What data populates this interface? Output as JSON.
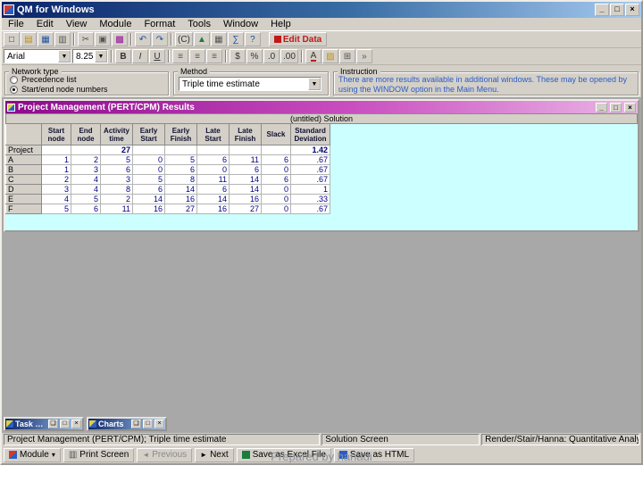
{
  "window": {
    "title": "QM for Windows",
    "menu": [
      "File",
      "Edit",
      "View",
      "Module",
      "Format",
      "Tools",
      "Window",
      "Help"
    ]
  },
  "toolbar": {
    "edit_data_label": "Edit Data",
    "copy_c_label": "(C)",
    "font_name": "Arial",
    "font_size": "8.25",
    "bold_label": "B",
    "italic_label": "I",
    "underline_label": "U",
    "currency_label": "$",
    "percent_label": "%",
    "dec0_label": ".0",
    "dec00_label": ".00",
    "font_color_label": "A"
  },
  "options": {
    "network_type_label": "Network type",
    "radio_precedence": "Precedence list",
    "radio_startend": "Start/end node numbers",
    "method_label": "Method",
    "method_value": "Triple time estimate",
    "instruction_label": "Instruction",
    "instruction_text": "There are more results available in additional windows. These may be opened by using the WINDOW option in the Main Menu."
  },
  "results": {
    "title": "Project Management (PERT/CPM) Results",
    "table_title": "(untitled) Solution",
    "columns": [
      "Start node",
      "End node",
      "Activity time",
      "Early Start",
      "Early Finish",
      "Late Start",
      "Late Finish",
      "Slack",
      "Standard Deviation"
    ],
    "rows": [
      {
        "name": "Project",
        "values": [
          "",
          "",
          "27",
          "",
          "",
          "",
          "",
          "",
          "1.42"
        ],
        "bold": true
      },
      {
        "name": "A",
        "values": [
          "1",
          "2",
          "5",
          "0",
          "5",
          "6",
          "11",
          "6",
          ".67"
        ]
      },
      {
        "name": "B",
        "values": [
          "1",
          "3",
          "6",
          "0",
          "6",
          "0",
          "6",
          "0",
          ".67"
        ]
      },
      {
        "name": "C",
        "values": [
          "2",
          "4",
          "3",
          "5",
          "8",
          "11",
          "14",
          "6",
          ".67"
        ]
      },
      {
        "name": "D",
        "values": [
          "3",
          "4",
          "8",
          "6",
          "14",
          "6",
          "14",
          "0",
          "1"
        ]
      },
      {
        "name": "E",
        "values": [
          "4",
          "5",
          "2",
          "14",
          "16",
          "14",
          "16",
          "0",
          ".33"
        ]
      },
      {
        "name": "F",
        "values": [
          "5",
          "6",
          "11",
          "16",
          "27",
          "16",
          "27",
          "0",
          ".67"
        ]
      }
    ]
  },
  "minimized_windows": [
    {
      "title": "Task Times"
    },
    {
      "title": "Charts"
    }
  ],
  "statusbar": {
    "left": "Project Management (PERT/CPM); Triple time estimate",
    "middle": "Solution Screen",
    "right": "Render/Stair/Hanna: Quantitative Analysis for Mgt"
  },
  "bottom_toolbar": {
    "module_label": "Module",
    "print_screen_label": "Print Screen",
    "previous_label": "Previous",
    "next_label": "Next",
    "save_excel_label": "Save as Excel File",
    "save_html_label": "Save as HTML"
  },
  "watermark": "Prepared by hanadi"
}
